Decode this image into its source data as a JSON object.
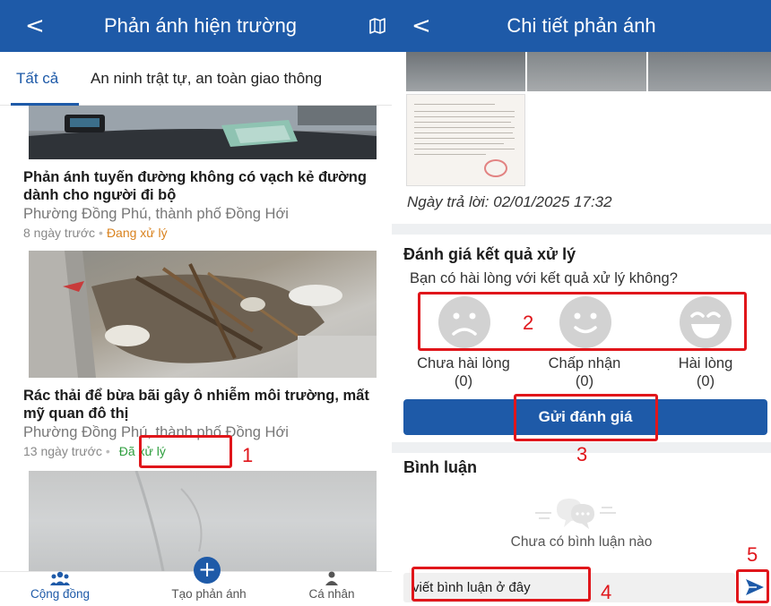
{
  "left": {
    "header": {
      "back_icon": "chevron-left-icon",
      "title": "Phản ánh hiện trường",
      "map_icon": "map-icon"
    },
    "tabs": [
      {
        "label": "Tất cả",
        "active": true
      },
      {
        "label": "An ninh trật tự, an toàn giao thông",
        "active": false
      }
    ],
    "posts": [
      {
        "title": "Phản ánh tuyến đường không có vạch kẻ đường dành cho người đi bộ",
        "location": "Phường Đồng Phú, thành phố Đồng Hới",
        "time": "8 ngày trước",
        "status": "Đang xử lý",
        "status_color": "#d9821e"
      },
      {
        "title": "Rác thải để bừa bãi gây ô nhiễm môi trường, mất mỹ quan đô thị",
        "location": "Phường Đồng Phú, thành phố Đồng Hới",
        "time": "13 ngày trước",
        "status": "Đã xử lý",
        "status_color": "#2e9e3e"
      }
    ],
    "bottom_nav": [
      {
        "label": "Cộng đồng",
        "icon": "community-icon",
        "active": true
      },
      {
        "label": "Tạo phản ánh",
        "icon": "plus-icon",
        "active": false
      },
      {
        "label": "Cá nhân",
        "icon": "person-icon",
        "active": false
      }
    ]
  },
  "right": {
    "header": {
      "back_icon": "chevron-left-icon",
      "title": "Chi tiết phản ánh"
    },
    "reply_date": "Ngày trả lời: 02/01/2025 17:32",
    "rating": {
      "title": "Đánh giá kết quả xử lý",
      "question": "Bạn có hài lòng với kết quả xử lý không?",
      "options": [
        {
          "label": "Chưa hài lòng",
          "count": "(0)",
          "icon": "sad-face-icon"
        },
        {
          "label": "Chấp nhận",
          "count": "(0)",
          "icon": "neutral-face-icon"
        },
        {
          "label": "Hài lòng",
          "count": "(0)",
          "icon": "happy-face-icon"
        }
      ],
      "submit_label": "Gửi đánh giá"
    },
    "comments": {
      "title": "Bình luận",
      "empty_text": "Chưa có bình luận nào",
      "input_placeholder": "viết bình luận ở đây",
      "send_icon": "send-icon"
    }
  },
  "annotations": {
    "numbers": [
      "1",
      "2",
      "3",
      "4",
      "5"
    ],
    "color": "#e0161b"
  },
  "colors": {
    "primary": "#1e5aa8",
    "pending": "#d9821e",
    "done": "#2e9e3e"
  }
}
